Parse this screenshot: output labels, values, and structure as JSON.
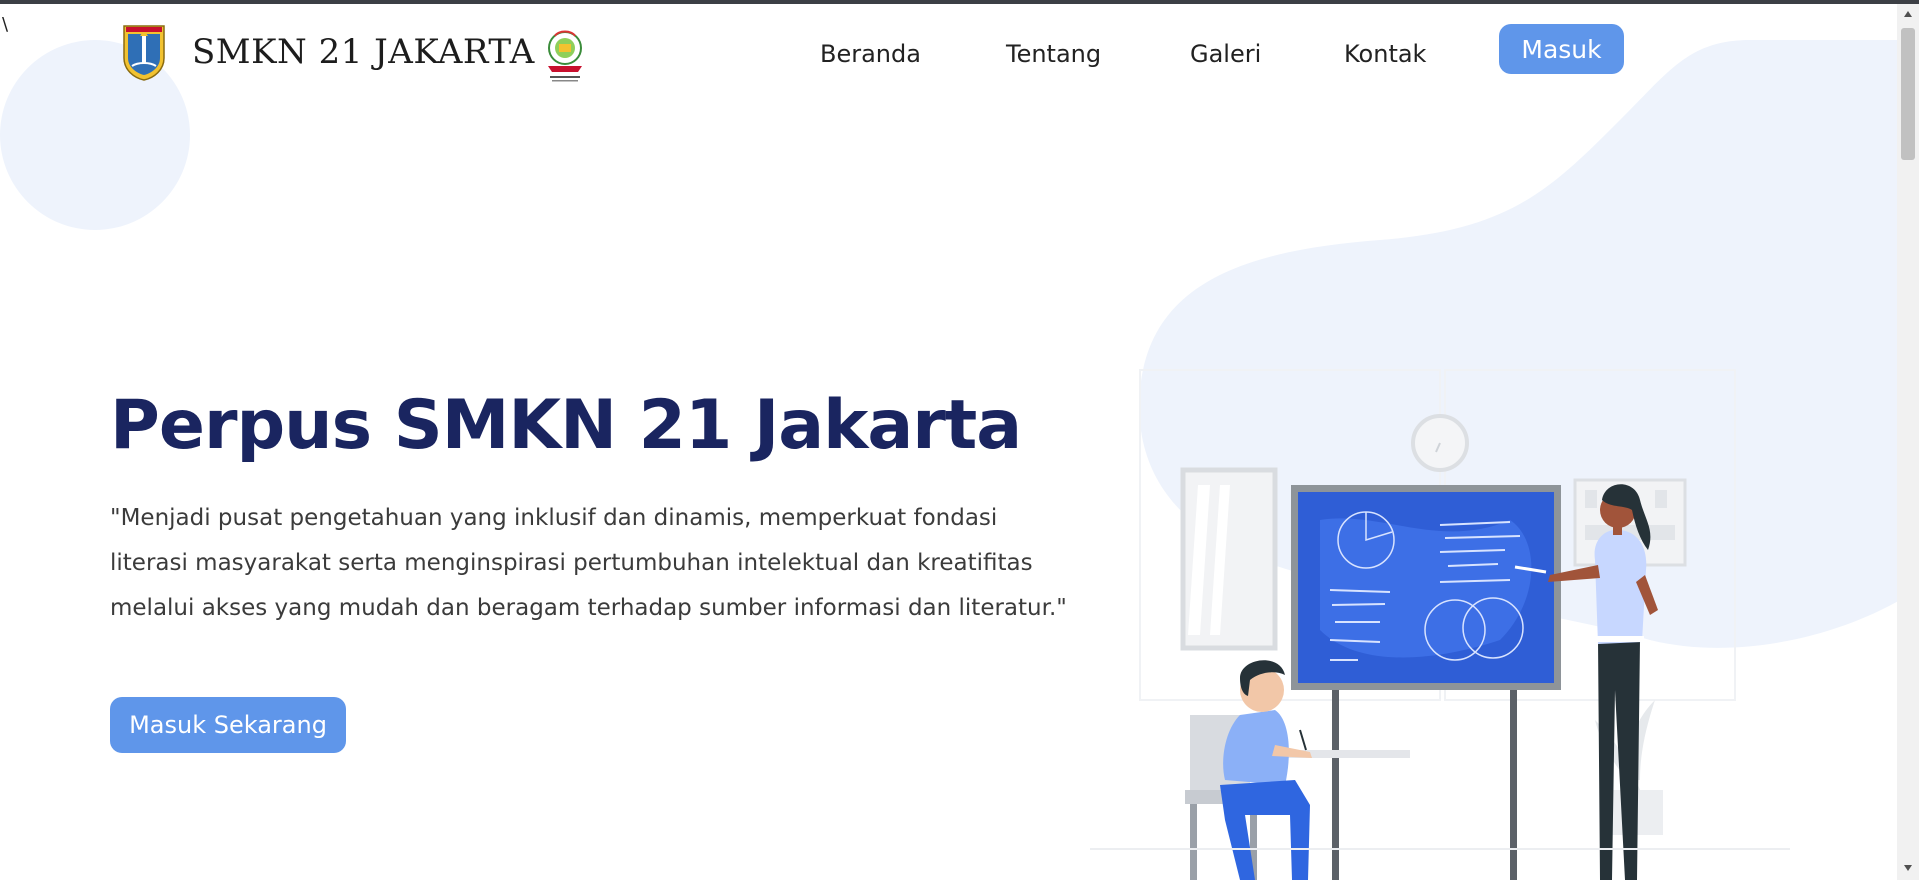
{
  "stray_text": "\\",
  "header": {
    "brand_name": "SMKN 21 JAKARTA",
    "logo_left_icon": "jakarta-emblem-icon",
    "logo_right_icon": "school-crest-icon"
  },
  "nav": {
    "items": [
      {
        "label": "Beranda"
      },
      {
        "label": "Tentang"
      },
      {
        "label": "Galeri"
      },
      {
        "label": "Kontak"
      }
    ],
    "login_label": "Masuk"
  },
  "hero": {
    "title": "Perpus SMKN 21 Jakarta",
    "quote": "\"Menjadi pusat pengetahuan yang inklusif dan dinamis, memperkuat fondasi literasi masyarakat serta menginspirasi pertumbuhan intelektual dan kreatifitas melalui akses yang mudah dan beragam terhadap sumber informasi dan literatur.\"",
    "cta_label": "Masuk Sekarang"
  },
  "colors": {
    "accent": "#5f96ea",
    "heading": "#1a2560",
    "background_blob": "#eef3fc"
  }
}
